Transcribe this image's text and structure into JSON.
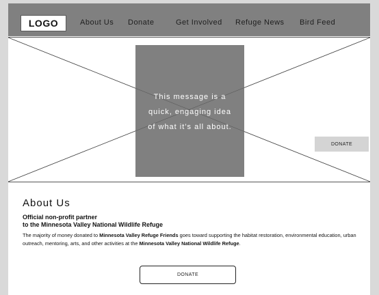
{
  "header": {
    "logo": "LOGO",
    "nav": [
      "About Us",
      "Donate",
      "Get Involved",
      "Refuge News",
      "Bird Feed"
    ]
  },
  "hero": {
    "message_lines": [
      "This message is a",
      "quick, engaging idea",
      "of what it’s all about."
    ],
    "donate_label": "DONATE"
  },
  "about": {
    "title": "About Us",
    "subtitle_line1": "Official non-profit partner",
    "subtitle_line2": "to the Minnesota Valley National Wildlife Refuge",
    "para_part1": "The majority of money donated to ",
    "para_bold1": "Minnesota Valley Refuge Friends",
    "para_part2": " goes toward supporting the habitat restoration, environmental education, urban outreach, mentoring, arts, and other activities at the ",
    "para_bold2": "Minnesota Valley National Wildlife Refuge",
    "para_part3": ".",
    "donate_label": "DONATE"
  },
  "colors": {
    "header_bg": "#808080",
    "hero_box": "#808080",
    "page_bg": "#d9d9d9"
  }
}
